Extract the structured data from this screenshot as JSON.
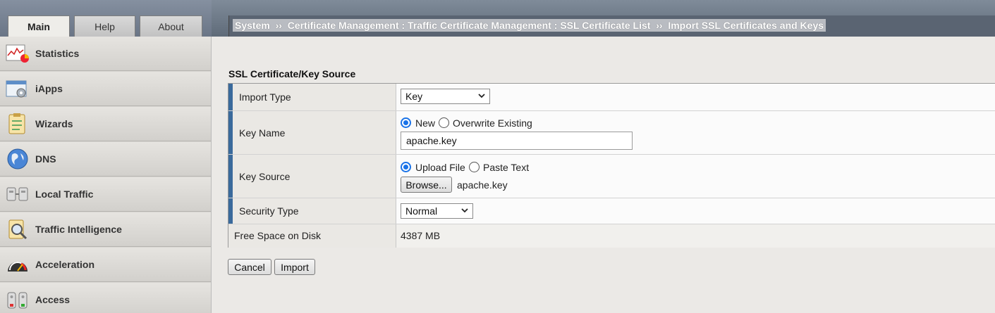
{
  "tabs": [
    {
      "label": "Main",
      "active": true
    },
    {
      "label": "Help",
      "active": false
    },
    {
      "label": "About",
      "active": false
    }
  ],
  "breadcrumb": "System  ››  Certificate Management : Traffic Certificate Management : SSL Certificate List  ››  Import SSL Certificates and Keys",
  "sidebar": {
    "items": [
      {
        "label": "Statistics",
        "icon": "statistics-icon"
      },
      {
        "label": "iApps",
        "icon": "iapps-icon"
      },
      {
        "label": "Wizards",
        "icon": "wizards-icon"
      },
      {
        "label": "DNS",
        "icon": "dns-globe-icon"
      },
      {
        "label": "Local Traffic",
        "icon": "local-traffic-icon"
      },
      {
        "label": "Traffic Intelligence",
        "icon": "traffic-intelligence-icon"
      },
      {
        "label": "Acceleration",
        "icon": "acceleration-gauge-icon"
      },
      {
        "label": "Access",
        "icon": "access-icon"
      }
    ]
  },
  "form": {
    "section_title": "SSL Certificate/Key Source",
    "import_type": {
      "label": "Import Type",
      "value": "Key"
    },
    "key_name": {
      "label": "Key Name",
      "option_new": "New",
      "option_overwrite": "Overwrite Existing",
      "selected": "New",
      "value": "apache.key"
    },
    "key_source": {
      "label": "Key Source",
      "option_upload": "Upload File",
      "option_paste": "Paste Text",
      "selected": "Upload File",
      "browse_label": "Browse...",
      "file_name": "apache.key"
    },
    "security_type": {
      "label": "Security Type",
      "value": "Normal"
    },
    "free_space": {
      "label": "Free Space on Disk",
      "value": "4387 MB"
    }
  },
  "buttons": {
    "cancel": "Cancel",
    "import": "Import"
  },
  "colors": {
    "accent": "#3a6a9c",
    "radio": "#1a73e8",
    "header": "#5a6472"
  }
}
